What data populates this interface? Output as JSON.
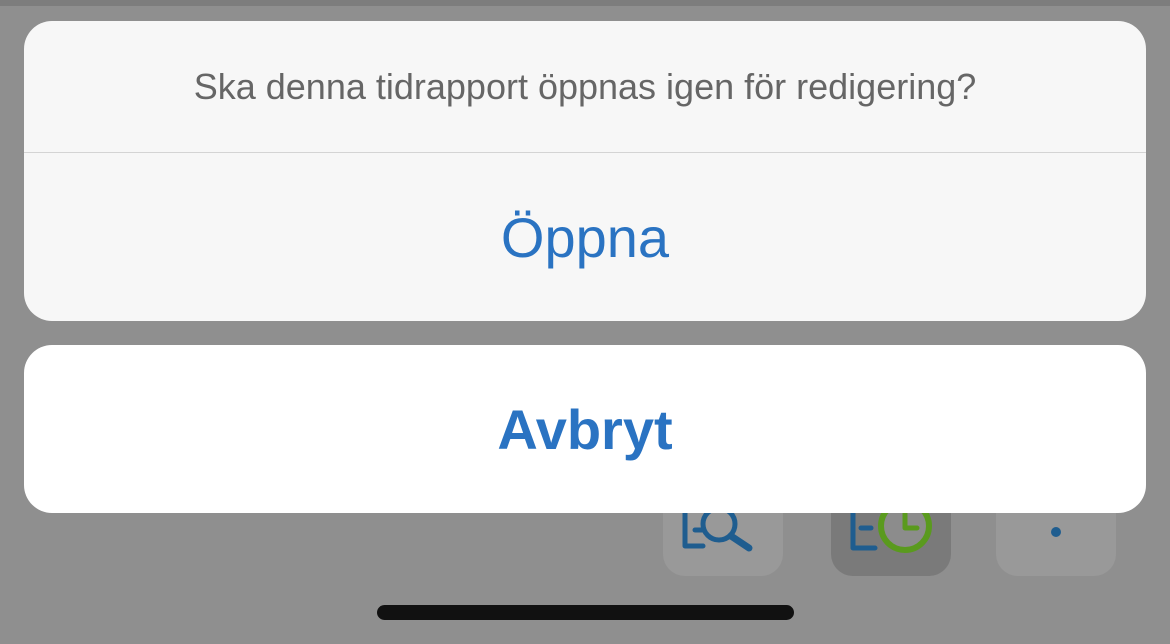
{
  "action_sheet": {
    "message": "Ska denna tidrapport öppnas igen för redigering?",
    "open_label": "Öppna",
    "cancel_label": "Avbryt"
  },
  "toolbar": {
    "items": [
      {
        "icon": "document-search-icon"
      },
      {
        "icon": "document-clock-icon",
        "active": true
      },
      {
        "icon": "more-vertical-icon"
      }
    ]
  },
  "colors": {
    "accent": "#2a73c2",
    "clock_green": "#5a9a1e",
    "overlay": "#8f8f8f"
  }
}
